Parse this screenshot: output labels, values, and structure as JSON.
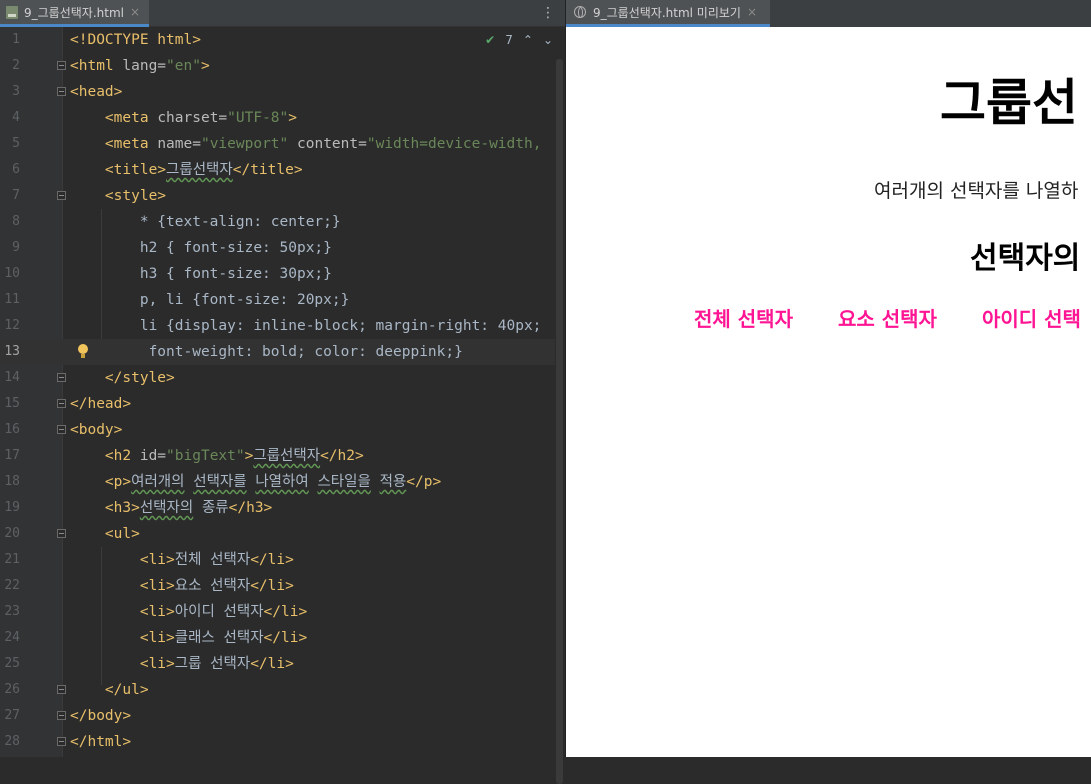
{
  "editor": {
    "tab_title": "9_그룹선택자.html",
    "tab_close": "×",
    "more_icon": "⋮",
    "inspection_count": "7",
    "lines": [
      {
        "n": "1",
        "segs": [
          [
            "tag",
            "<!DOCTYPE html>"
          ]
        ]
      },
      {
        "n": "2",
        "segs": [
          [
            "tag",
            "<html "
          ],
          [
            "attr",
            "lang="
          ],
          [
            "val",
            "\"en\""
          ],
          [
            "tag",
            ">"
          ]
        ]
      },
      {
        "n": "3",
        "segs": [
          [
            "tag",
            "<head>"
          ]
        ]
      },
      {
        "n": "4",
        "segs": [
          [
            "txt",
            "    "
          ],
          [
            "tag",
            "<meta "
          ],
          [
            "attr",
            "charset="
          ],
          [
            "val",
            "\"UTF-8\""
          ],
          [
            "tag",
            ">"
          ]
        ]
      },
      {
        "n": "5",
        "segs": [
          [
            "txt",
            "    "
          ],
          [
            "tag",
            "<meta "
          ],
          [
            "attr",
            "name="
          ],
          [
            "val",
            "\"viewport\""
          ],
          [
            "attr",
            " content="
          ],
          [
            "val",
            "\"width=device-width,"
          ]
        ]
      },
      {
        "n": "6",
        "segs": [
          [
            "txt",
            "    "
          ],
          [
            "tag",
            "<title>"
          ],
          [
            "sq",
            "그룹선택자"
          ],
          [
            "tag",
            "</title>"
          ]
        ]
      },
      {
        "n": "7",
        "segs": [
          [
            "txt",
            "    "
          ],
          [
            "tag",
            "<style>"
          ]
        ]
      },
      {
        "n": "8",
        "segs": [
          [
            "txt",
            "        * {text-align: center;}"
          ]
        ]
      },
      {
        "n": "9",
        "segs": [
          [
            "txt",
            "        h2 { font-size: 50px;}"
          ]
        ]
      },
      {
        "n": "10",
        "segs": [
          [
            "txt",
            "        h3 { font-size: 30px;}"
          ]
        ]
      },
      {
        "n": "11",
        "segs": [
          [
            "txt",
            "        p, li {font-size: 20px;}"
          ]
        ]
      },
      {
        "n": "12",
        "segs": [
          [
            "txt",
            "        li {display: inline-block; margin-right: 40px;"
          ]
        ]
      },
      {
        "n": "13",
        "segs": [
          [
            "txt",
            "         font-weight: bold; color: deeppink;}"
          ]
        ]
      },
      {
        "n": "14",
        "segs": [
          [
            "txt",
            "    "
          ],
          [
            "tag",
            "</style>"
          ]
        ]
      },
      {
        "n": "15",
        "segs": [
          [
            "tag",
            "</head>"
          ]
        ]
      },
      {
        "n": "16",
        "segs": [
          [
            "tag",
            "<body>"
          ]
        ]
      },
      {
        "n": "17",
        "segs": [
          [
            "txt",
            "    "
          ],
          [
            "tag",
            "<h2 "
          ],
          [
            "attr",
            "id="
          ],
          [
            "val",
            "\"bigText\""
          ],
          [
            "tag",
            ">"
          ],
          [
            "sq",
            "그룹선택자"
          ],
          [
            "tag",
            "</h2>"
          ]
        ]
      },
      {
        "n": "18",
        "segs": [
          [
            "txt",
            "    "
          ],
          [
            "tag",
            "<p>"
          ],
          [
            "sq",
            "여러개의"
          ],
          [
            "txt",
            " "
          ],
          [
            "sq",
            "선택자를"
          ],
          [
            "txt",
            " "
          ],
          [
            "sq",
            "나열하여"
          ],
          [
            "txt",
            " "
          ],
          [
            "sq",
            "스타일을"
          ],
          [
            "txt",
            " "
          ],
          [
            "sq",
            "적용"
          ],
          [
            "tag",
            "</p>"
          ]
        ]
      },
      {
        "n": "19",
        "segs": [
          [
            "txt",
            "    "
          ],
          [
            "tag",
            "<h3>"
          ],
          [
            "sq",
            "선택자의"
          ],
          [
            "txt",
            " 종류"
          ],
          [
            "tag",
            "</h3>"
          ]
        ]
      },
      {
        "n": "20",
        "segs": [
          [
            "txt",
            "    "
          ],
          [
            "tag",
            "<ul>"
          ]
        ]
      },
      {
        "n": "21",
        "segs": [
          [
            "txt",
            "        "
          ],
          [
            "tag",
            "<li>"
          ],
          [
            "txt",
            "전체 선택자"
          ],
          [
            "tag",
            "</li>"
          ]
        ]
      },
      {
        "n": "22",
        "segs": [
          [
            "txt",
            "        "
          ],
          [
            "tag",
            "<li>"
          ],
          [
            "txt",
            "요소 선택자"
          ],
          [
            "tag",
            "</li>"
          ]
        ]
      },
      {
        "n": "23",
        "segs": [
          [
            "txt",
            "        "
          ],
          [
            "tag",
            "<li>"
          ],
          [
            "txt",
            "아이디 선택자"
          ],
          [
            "tag",
            "</li>"
          ]
        ]
      },
      {
        "n": "24",
        "segs": [
          [
            "txt",
            "        "
          ],
          [
            "tag",
            "<li>"
          ],
          [
            "txt",
            "클래스 선택자"
          ],
          [
            "tag",
            "</li>"
          ]
        ]
      },
      {
        "n": "25",
        "segs": [
          [
            "txt",
            "        "
          ],
          [
            "tag",
            "<li>"
          ],
          [
            "txt",
            "그룹 선택자"
          ],
          [
            "tag",
            "</li>"
          ]
        ]
      },
      {
        "n": "26",
        "segs": [
          [
            "txt",
            "    "
          ],
          [
            "tag",
            "</ul>"
          ]
        ]
      },
      {
        "n": "27",
        "segs": [
          [
            "tag",
            "</body>"
          ]
        ]
      },
      {
        "n": "28",
        "segs": [
          [
            "tag",
            "</html>"
          ]
        ]
      }
    ]
  },
  "preview": {
    "tab_title": "9_그룹선택자.html 미리보기",
    "tab_close": "×",
    "h2": "그룹선",
    "p": "여러개의 선택자를 나열하",
    "h3": "선택자의",
    "items": [
      "전체 선택자",
      "요소 선택자",
      "아이디 선택"
    ]
  },
  "colors": {
    "tag": "#e8bf6a",
    "attr": "#bababa",
    "value": "#6a8759",
    "text": "#a9b7c6",
    "accent": "#4a88c7",
    "li_color": "#ff1493"
  }
}
